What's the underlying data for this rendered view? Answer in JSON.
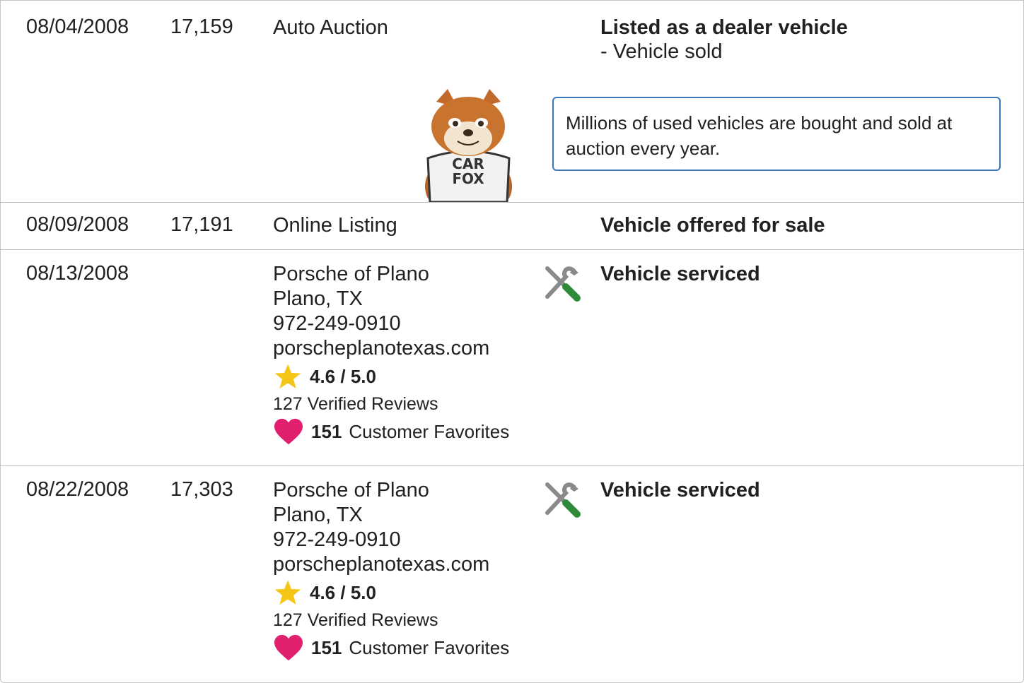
{
  "rows": [
    {
      "date": "08/04/2008",
      "odometer": "17,159",
      "source": "Auto Auction",
      "comment_title": "Listed as a dealer vehicle",
      "comment_sub": "- Vehicle sold",
      "tip": "Millions of used vehicles are bought and sold at auction every year.",
      "mascot_text": [
        "CAR",
        "FOX"
      ]
    },
    {
      "date": "08/09/2008",
      "odometer": "17,191",
      "source": "Online Listing",
      "comment_title": "Vehicle offered for sale"
    },
    {
      "date": "08/13/2008",
      "odometer": "",
      "dealer": {
        "name": "Porsche of Plano",
        "location": "Plano, TX",
        "phone": "972-249-0910",
        "website": "porscheplanotexas.com",
        "rating": "4.6 / 5.0",
        "reviews": "127 Verified Reviews",
        "favorites_count": "151",
        "favorites_label": "Customer Favorites"
      },
      "comment_title": "Vehicle serviced"
    },
    {
      "date": "08/22/2008",
      "odometer": "17,303",
      "dealer": {
        "name": "Porsche of Plano",
        "location": "Plano, TX",
        "phone": "972-249-0910",
        "website": "porscheplanotexas.com",
        "rating": "4.6 / 5.0",
        "reviews": "127 Verified Reviews",
        "favorites_count": "151",
        "favorites_label": "Customer Favorites"
      },
      "comment_title": "Vehicle serviced"
    }
  ],
  "icons": {
    "service": "wrench-screwdriver-icon",
    "star": "star-icon",
    "heart": "heart-icon"
  },
  "colors": {
    "tip_border": "#3777bc",
    "star": "#f5c518",
    "heart": "#e0206f",
    "service_green": "#2e8b3a",
    "service_gray": "#8a8a8a"
  }
}
